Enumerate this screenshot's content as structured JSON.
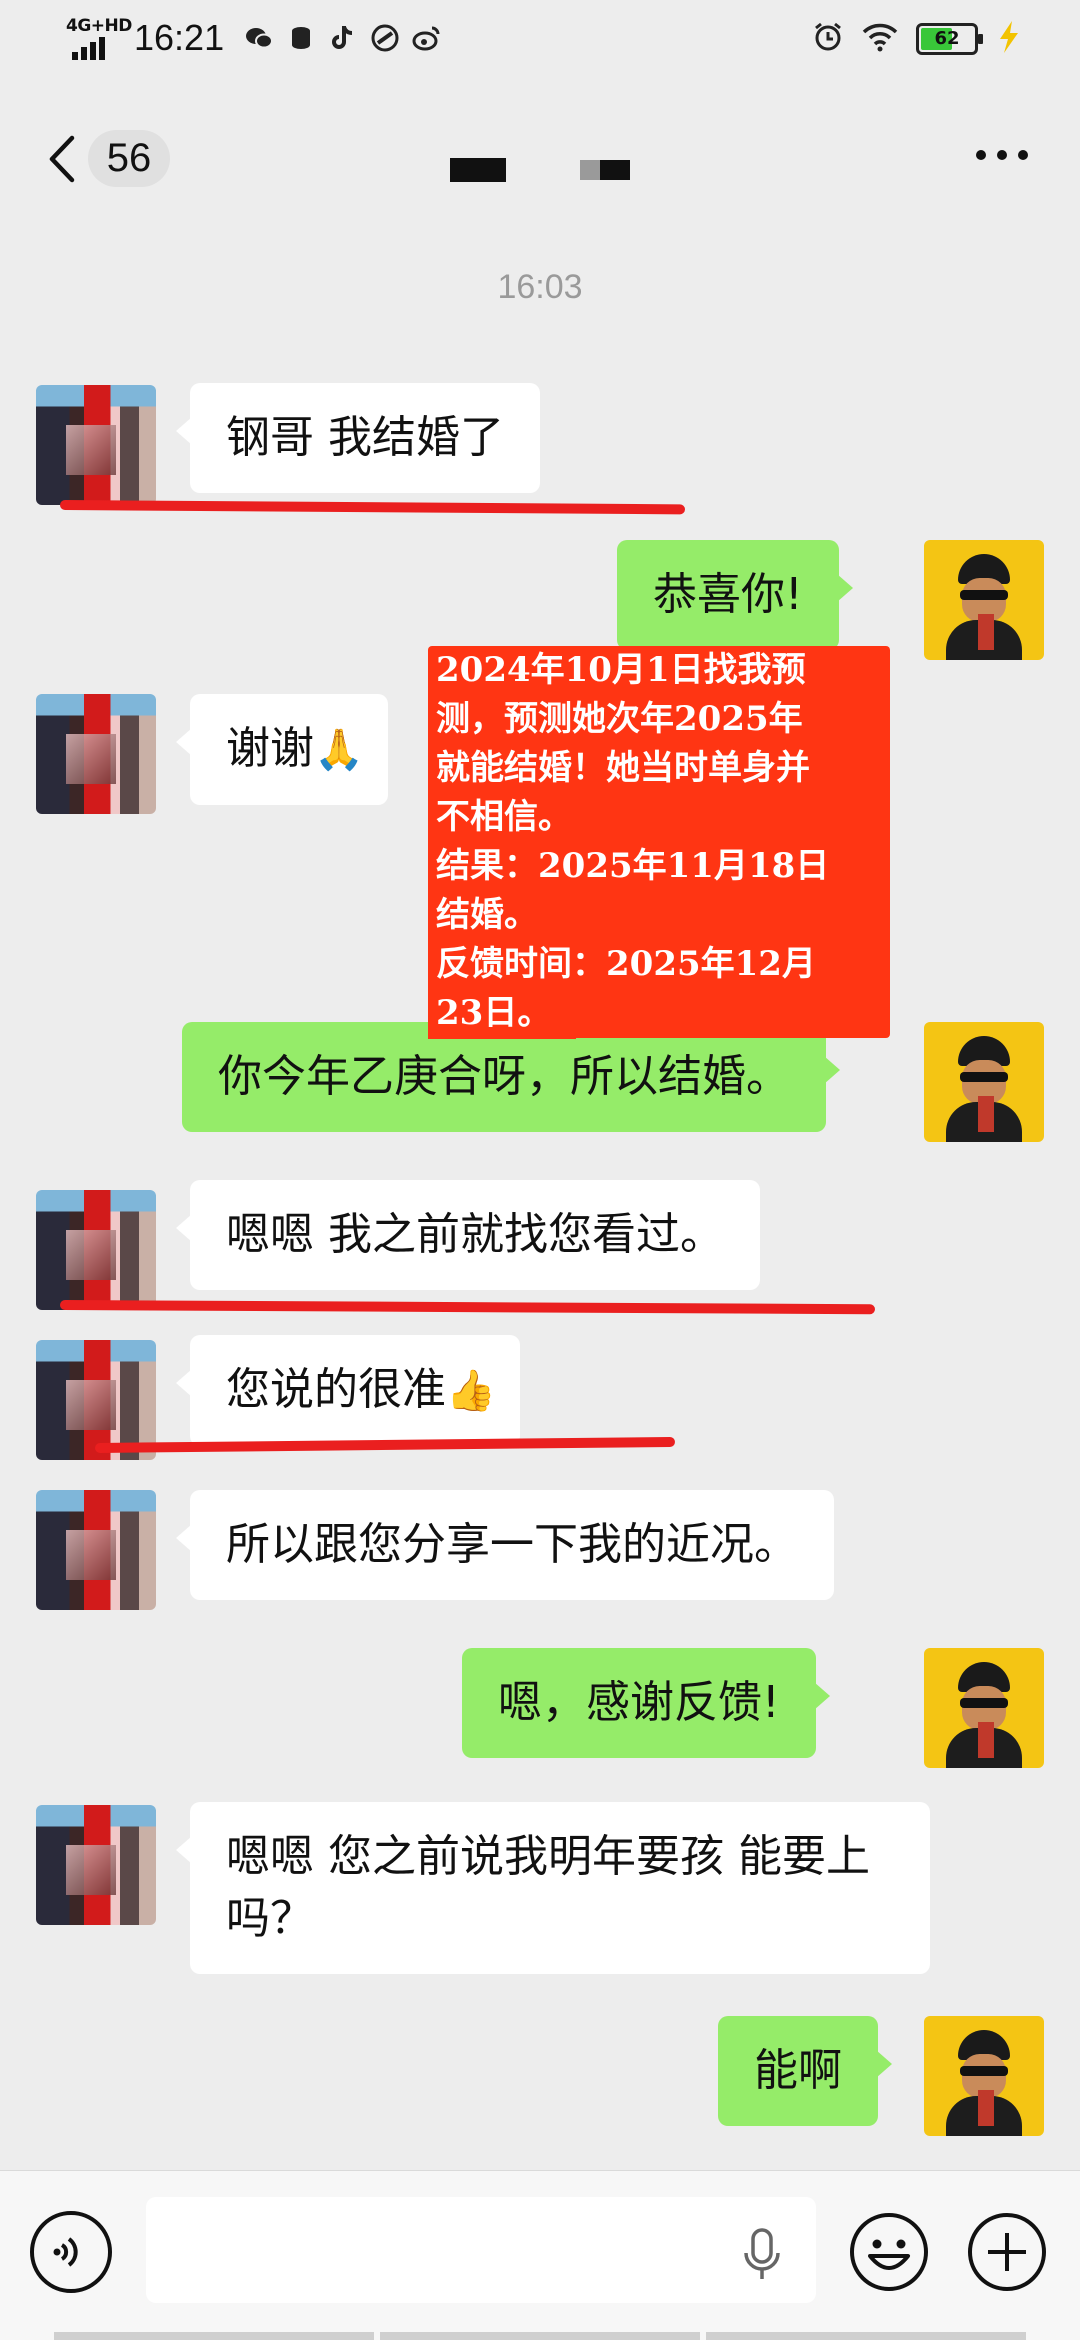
{
  "status_bar": {
    "network": "4G+HD",
    "time": "16:21",
    "battery": "62",
    "battery_level": 0.62,
    "icons": [
      "wechat-icon",
      "database-icon",
      "tiktok-icon",
      "app-icon",
      "weibo-icon",
      "alarm-icon",
      "wifi-icon",
      "battery-icon",
      "charging-icon"
    ]
  },
  "nav": {
    "unread_count": "56",
    "icons": [
      "chevron-left-icon",
      "more-icon"
    ]
  },
  "timestamp": "16:03",
  "messages": [
    {
      "side": "in",
      "text": "钢哥  我结婚了"
    },
    {
      "side": "out",
      "text": "恭喜你!"
    },
    {
      "side": "in",
      "text": "谢谢",
      "emoji": "🙏"
    },
    {
      "side": "out",
      "text": "你今年乙庚合呀，所以结婚。"
    },
    {
      "side": "in",
      "text": "嗯嗯  我之前就找您看过。"
    },
    {
      "side": "in",
      "text": "您说的很准",
      "emoji": "👍"
    },
    {
      "side": "in",
      "text": "所以跟您分享一下我的近况。"
    },
    {
      "side": "out",
      "text": "嗯，感谢反馈!"
    },
    {
      "side": "in",
      "text": "嗯嗯  您之前说我明年要孩  能要上吗？"
    },
    {
      "side": "out",
      "text": "能啊"
    }
  ],
  "note": {
    "lines": [
      "2024年10月1日找我预",
      "测，预测她次年2025年",
      "就能结婚！她当时单身并",
      "不相信。",
      "结果：2025年11月18日",
      "结婚。",
      "反馈时间：2025年12月",
      "23日。"
    ],
    "color": "#ff3513"
  },
  "input": {
    "icons": [
      "voice-icon",
      "microphone-icon",
      "emoji-icon",
      "plus-icon"
    ]
  },
  "colors": {
    "background": "#ededed",
    "outgoing_bubble": "#95ec69",
    "incoming_bubble": "#ffffff",
    "underline": "#ea1f1f"
  }
}
